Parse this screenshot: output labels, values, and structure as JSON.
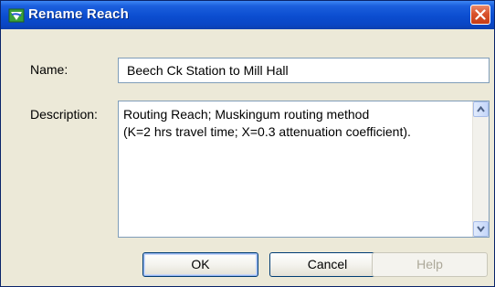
{
  "window": {
    "title": "Rename Reach",
    "icon": "reach-icon",
    "close_icon": "close-icon"
  },
  "form": {
    "name_label": "Name:",
    "name_value": "Beech Ck Station to Mill Hall",
    "description_label": "Description:",
    "description_value": "Routing Reach; Muskingum routing method\n(K=2 hrs travel time; X=0.3 attenuation coefficient)."
  },
  "buttons": {
    "ok": "OK",
    "cancel": "Cancel",
    "help": "Help"
  },
  "colors": {
    "titlebar": "#0a46c4",
    "window_bg": "#ece9d8",
    "close_button": "#d9532d",
    "disabled_text": "#aca899"
  }
}
